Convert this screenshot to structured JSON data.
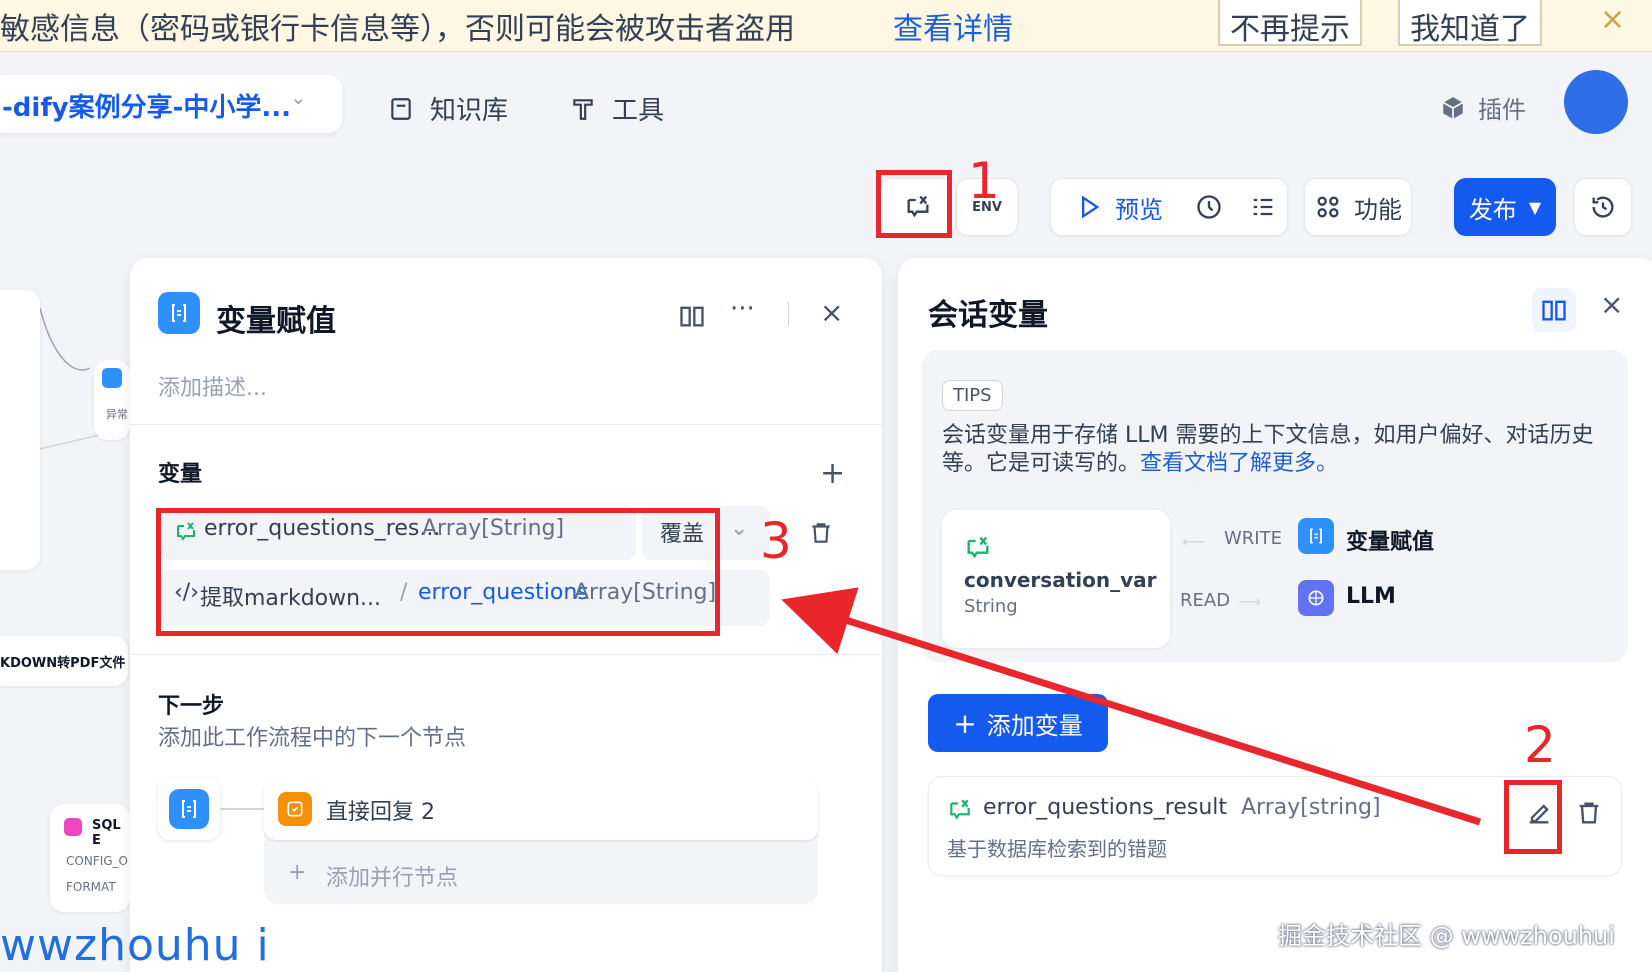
{
  "banner": {
    "message": "敏感信息（密码或银行卡信息等），否则可能会被攻击者盗用",
    "link": "查看详情",
    "dismiss": "不再提示",
    "ack": "我知道了",
    "close": "×"
  },
  "header": {
    "app_name": "-dify案例分享-中小学...",
    "nav": [
      "知识库",
      "工具"
    ],
    "plugin": "插件"
  },
  "toolbar": {
    "env": "ENV",
    "preview": "预览",
    "features": "功能",
    "publish": "发布"
  },
  "annotations": [
    "1",
    "2",
    "3"
  ],
  "canvas": {
    "node_labels": [
      "异常",
      "KDOWN转PDF文件",
      "SQL E",
      "CONFIG_O",
      "FORMAT"
    ]
  },
  "left_panel": {
    "title": "变量赋值",
    "desc_placeholder": "添加描述...",
    "variables_title": "变量",
    "assign_var": "error_questions_res...",
    "assign_type": "Array[String]",
    "mode": "覆盖",
    "source_node": "提取markdown...",
    "source_var": "error_questions",
    "source_type": "Array[String]",
    "next_title": "下一步",
    "next_desc": "添加此工作流程中的下一个节点",
    "next_node": "直接回复 2",
    "add_parallel": "添加并行节点"
  },
  "right_panel": {
    "title": "会话变量",
    "tips_tag": "TIPS",
    "tips_text": "会话变量用于存储 LLM 需要的上下文信息，如用户偏好、对话历史等。它是可读写的。",
    "tips_link": "查看文档了解更多。",
    "demo_var": "conversation_var",
    "demo_type": "String",
    "write_label": "WRITE",
    "read_label": "READ",
    "write_node": "变量赋值",
    "read_node": "LLM",
    "add_var": "添加变量",
    "var_name": "error_questions_result",
    "var_type": "Array[string]",
    "var_desc": "基于数据库检索到的错题"
  },
  "watermark": "掘金技术社区 @ wwwzhouhui",
  "corner_text": "wwzhouhu i",
  "colors": {
    "accent": "#155aef",
    "annotation": "#e8262b",
    "banner_bg": "#fdf7e3"
  }
}
